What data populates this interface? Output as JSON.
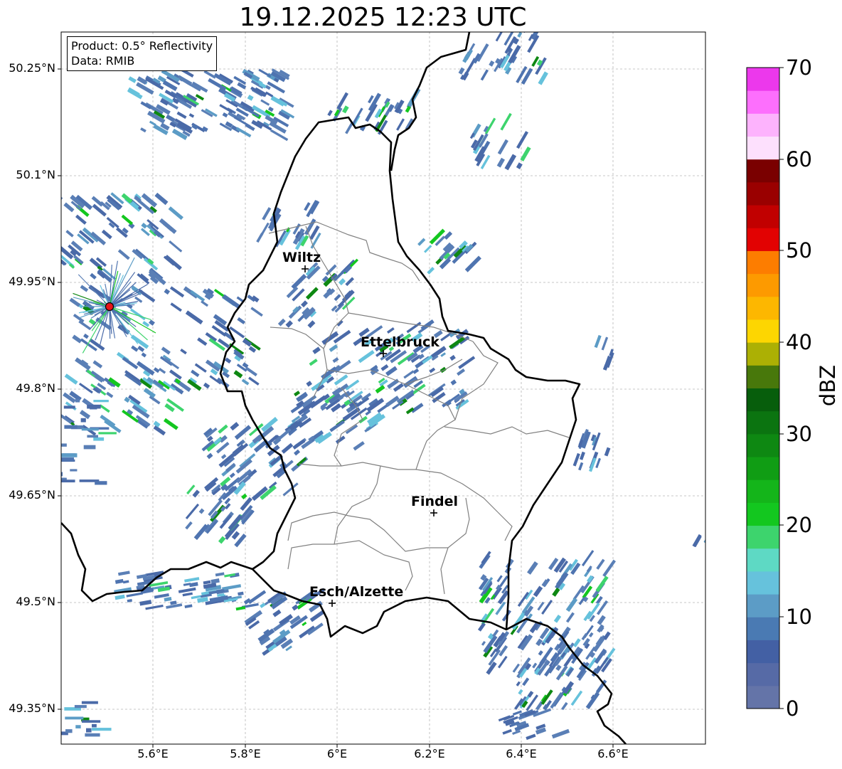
{
  "title": "19.12.2025 12:23 UTC",
  "info": {
    "product": "Product: 0.5° Reflectivity",
    "data": "Data: RMIB"
  },
  "lat_ticks": [
    "50.25°N",
    "50.1°N",
    "49.95°N",
    "49.8°N",
    "49.65°N",
    "49.5°N",
    "49.35°N"
  ],
  "lon_ticks": [
    "5.6°E",
    "5.8°E",
    "6°E",
    "6.2°E",
    "6.4°E",
    "6.6°E"
  ],
  "cities": [
    {
      "name": "Wiltz"
    },
    {
      "name": "Ettelbruck"
    },
    {
      "name": "Findel"
    },
    {
      "name": "Esch/Alzette"
    }
  ],
  "colorbar": {
    "label": "dBZ",
    "ticks": [
      "0",
      "10",
      "20",
      "30",
      "40",
      "50",
      "60",
      "70"
    ],
    "colors": [
      "#6474a8",
      "#566aa6",
      "#4360a4",
      "#4a7ab3",
      "#5c9cc6",
      "#66c2dc",
      "#5ed9c4",
      "#3dd46d",
      "#13c71f",
      "#14b51a",
      "#109d14",
      "#0e8812",
      "#0b7410",
      "#075e0c",
      "#48780b",
      "#acb004",
      "#fdd601",
      "#fdb700",
      "#fd9a00",
      "#fd7d00",
      "#e20202",
      "#c10000",
      "#9a0000",
      "#7a0000",
      "#fde0fd",
      "#fdb3fd",
      "#fd6ffd",
      "#ec38ec"
    ]
  },
  "colors": {
    "radar_site": "#e8141a"
  }
}
